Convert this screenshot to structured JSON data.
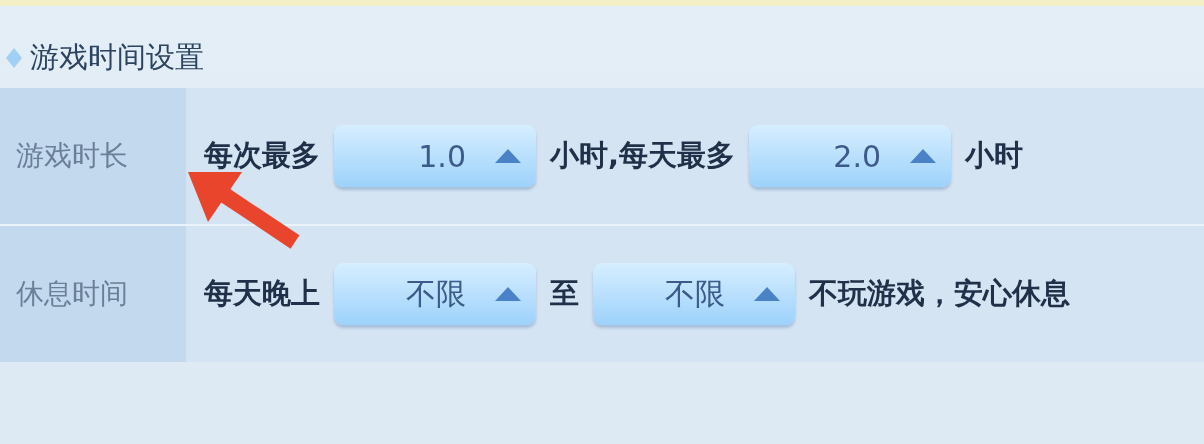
{
  "section": {
    "title": "游戏时间设置"
  },
  "rows": [
    {
      "label": "游戏时长",
      "parts": [
        {
          "kind": "text",
          "text": "每次最多"
        },
        {
          "kind": "select",
          "value": "1.0"
        },
        {
          "kind": "text",
          "text": "小时,每天最多"
        },
        {
          "kind": "select",
          "value": "2.0"
        },
        {
          "kind": "text",
          "text": "小时"
        }
      ]
    },
    {
      "label": "休息时间",
      "parts": [
        {
          "kind": "text",
          "text": "每天晚上"
        },
        {
          "kind": "select",
          "value": "不限"
        },
        {
          "kind": "text",
          "text": "至"
        },
        {
          "kind": "select",
          "value": "不限"
        },
        {
          "kind": "text",
          "text": "不玩游戏，安心休息"
        }
      ]
    }
  ]
}
